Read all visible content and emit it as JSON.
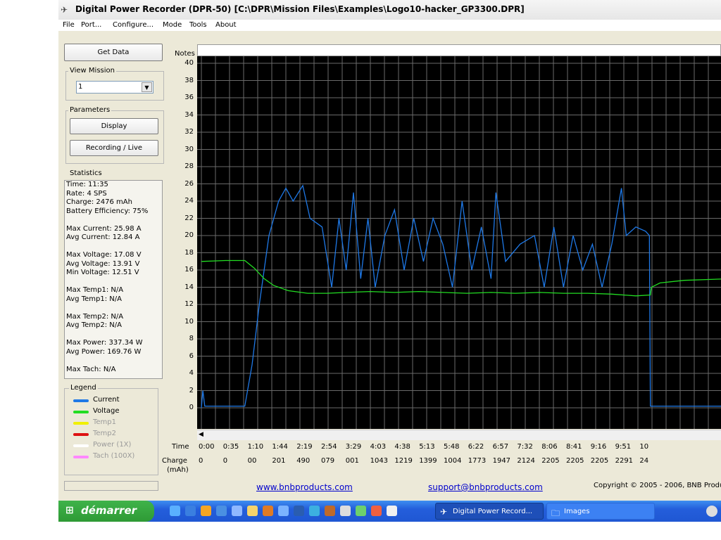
{
  "title": "Digital Power Recorder (DPR-50) [C:\\DPR\\Mission Files\\Examples\\Logo10-hacker_GP3300.DPR]",
  "menu": [
    "File",
    "Port...",
    "Configure...",
    "Mode",
    "Tools",
    "About"
  ],
  "left": {
    "get_data": "Get Data",
    "view_mission_label": "View Mission",
    "mission_value": "1",
    "parameters_label": "Parameters",
    "display_btn": "Display",
    "recording_btn": "Recording / Live",
    "statistics_label": "Statistics",
    "stats": [
      "Time: 11:35",
      "Rate: 4 SPS",
      "Charge: 2476 mAh",
      "Battery Efficiency: 75%",
      "",
      "Max Current: 25.98 A",
      "Avg Current: 12.84 A",
      "",
      "Max Voltage: 17.08 V",
      "Avg Voltage: 13.91 V",
      "Min Voltage: 12.51 V",
      "",
      "Max Temp1: N/A",
      "Avg Temp1: N/A",
      "",
      "Max Temp2: N/A",
      "Avg Temp2: N/A",
      "",
      "Max Power: 337.34 W",
      "Avg Power: 169.76 W",
      "",
      "Max Tach: N/A"
    ],
    "legend_label": "Legend",
    "legend": [
      {
        "name": "Current",
        "color": "#1e78e6",
        "enabled": true
      },
      {
        "name": "Voltage",
        "color": "#22dd22",
        "enabled": true
      },
      {
        "name": "Temp1",
        "color": "#f0f000",
        "enabled": false
      },
      {
        "name": "Temp2",
        "color": "#dd1111",
        "enabled": false
      },
      {
        "name": "Power (1X)",
        "color": "#ffffff",
        "enabled": false
      },
      {
        "name": "Tach   (100X)",
        "color": "#ff88ff",
        "enabled": false
      }
    ]
  },
  "chart_labels": {
    "notes": "Notes",
    "time": "Time",
    "charge": "Charge",
    "charge_unit": "(mAh)"
  },
  "chart_data": {
    "type": "line",
    "ylim": [
      0,
      40
    ],
    "yticks": [
      0,
      2,
      4,
      6,
      8,
      10,
      12,
      14,
      16,
      18,
      20,
      22,
      24,
      26,
      28,
      30,
      32,
      34,
      36,
      38,
      40
    ],
    "time_labels": [
      "0:00",
      "0:35",
      "1:10",
      "1:44",
      "2:19",
      "2:54",
      "3:29",
      "4:03",
      "4:38",
      "5:13",
      "5:48",
      "6:22",
      "6:57",
      "7:32",
      "8:06",
      "8:41",
      "9:16",
      "9:51",
      "10"
    ],
    "charge_labels": [
      "0",
      "0",
      "00",
      "201",
      "490",
      "079",
      "001",
      "1043",
      "1219",
      "1399",
      "1004",
      "1773",
      "1947",
      "2124",
      "2205",
      "2205",
      "2205",
      "2291",
      "24"
    ],
    "x_unit": "minutes",
    "series": [
      {
        "name": "Current",
        "color": "#1e78e6",
        "points": [
          [
            0,
            0
          ],
          [
            0.03,
            2
          ],
          [
            0.07,
            0.2
          ],
          [
            0.9,
            0.2
          ],
          [
            1.05,
            5
          ],
          [
            1.2,
            12
          ],
          [
            1.4,
            20
          ],
          [
            1.6,
            24
          ],
          [
            1.75,
            25.5
          ],
          [
            1.9,
            24
          ],
          [
            2.1,
            25.8
          ],
          [
            2.25,
            22
          ],
          [
            2.5,
            21
          ],
          [
            2.7,
            14
          ],
          [
            2.85,
            22
          ],
          [
            3.0,
            16
          ],
          [
            3.15,
            25
          ],
          [
            3.3,
            15
          ],
          [
            3.45,
            22
          ],
          [
            3.6,
            14
          ],
          [
            3.8,
            20
          ],
          [
            4.0,
            23
          ],
          [
            4.2,
            16
          ],
          [
            4.4,
            22
          ],
          [
            4.6,
            17
          ],
          [
            4.8,
            22
          ],
          [
            5.0,
            19
          ],
          [
            5.2,
            14
          ],
          [
            5.4,
            24
          ],
          [
            5.6,
            16
          ],
          [
            5.8,
            21
          ],
          [
            6.0,
            15
          ],
          [
            6.1,
            25
          ],
          [
            6.3,
            17
          ],
          [
            6.6,
            19
          ],
          [
            6.9,
            20
          ],
          [
            7.1,
            14
          ],
          [
            7.3,
            21
          ],
          [
            7.5,
            14
          ],
          [
            7.7,
            20
          ],
          [
            7.9,
            16
          ],
          [
            8.1,
            19
          ],
          [
            8.3,
            14
          ],
          [
            8.5,
            19
          ],
          [
            8.7,
            25.5
          ],
          [
            8.8,
            20
          ],
          [
            9.0,
            21
          ],
          [
            9.2,
            20.5
          ],
          [
            9.28,
            20
          ],
          [
            9.3,
            0.2
          ],
          [
            10.5,
            0.2
          ],
          [
            11.2,
            0.2
          ],
          [
            11.4,
            3
          ],
          [
            11.7,
            20
          ],
          [
            11.85,
            21
          ],
          [
            12.0,
            17
          ]
        ]
      },
      {
        "name": "Voltage",
        "color": "#22dd22",
        "points": [
          [
            0,
            17
          ],
          [
            0.5,
            17.1
          ],
          [
            0.9,
            17.1
          ],
          [
            1.1,
            16.2
          ],
          [
            1.3,
            15
          ],
          [
            1.5,
            14.2
          ],
          [
            1.8,
            13.6
          ],
          [
            2.2,
            13.3
          ],
          [
            2.6,
            13.3
          ],
          [
            3.0,
            13.4
          ],
          [
            3.5,
            13.5
          ],
          [
            4.0,
            13.4
          ],
          [
            4.5,
            13.5
          ],
          [
            5.0,
            13.4
          ],
          [
            5.5,
            13.3
          ],
          [
            6.0,
            13.4
          ],
          [
            6.5,
            13.3
          ],
          [
            7.0,
            13.4
          ],
          [
            7.5,
            13.3
          ],
          [
            8.0,
            13.3
          ],
          [
            8.5,
            13.2
          ],
          [
            9.0,
            13
          ],
          [
            9.3,
            13.1
          ],
          [
            9.32,
            14
          ],
          [
            9.5,
            14.5
          ],
          [
            10.0,
            14.8
          ],
          [
            10.5,
            14.9
          ],
          [
            11.0,
            15
          ],
          [
            11.2,
            15
          ],
          [
            11.5,
            14.3
          ],
          [
            11.7,
            13.5
          ],
          [
            11.9,
            13.2
          ],
          [
            12.0,
            13.9
          ]
        ]
      }
    ]
  },
  "footer": {
    "link1": "www.bnbproducts.com",
    "link2": "support@bnbproducts.com",
    "copyright": "Copyright © 2005 - 2006, BNB Products"
  },
  "taskbar": {
    "start": "démarrer",
    "tasks": [
      "Digital Power Record...",
      "Images"
    ]
  }
}
